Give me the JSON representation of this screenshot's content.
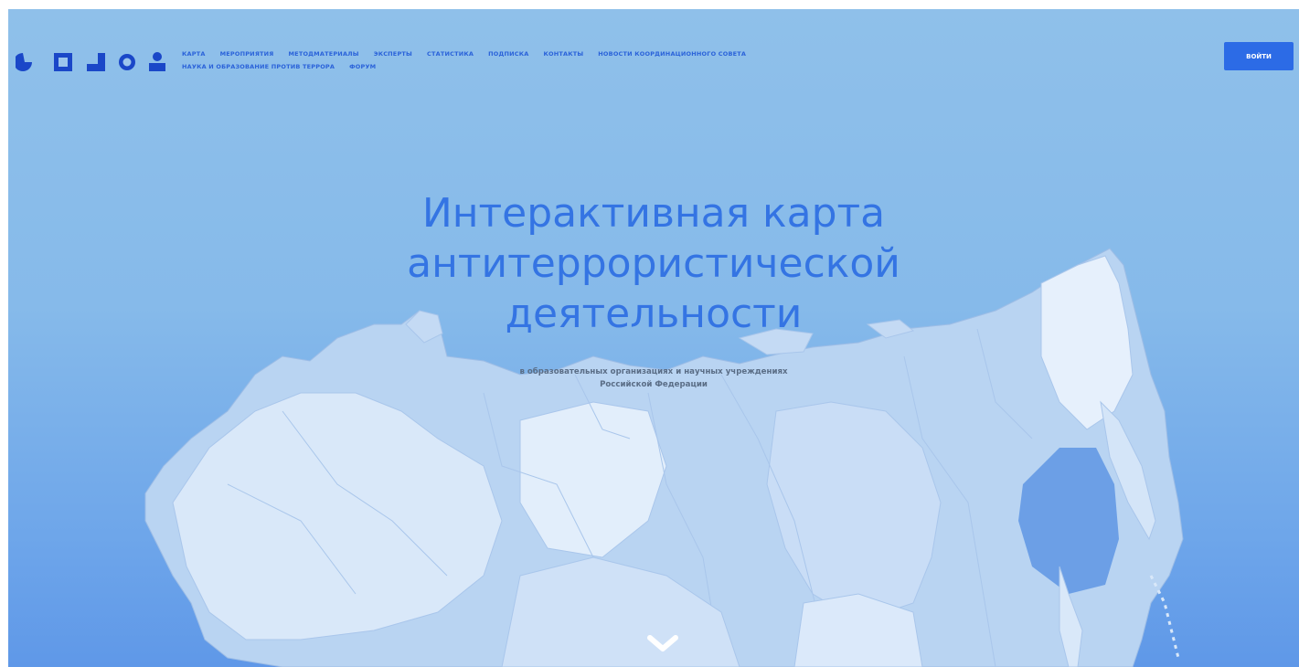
{
  "header": {
    "logo_name": "logo-shapes-icon",
    "nav_row1": [
      "КАРТА",
      "МЕРОПРИЯТИЯ",
      "МЕТОДМАТЕРИАЛЫ",
      "ЭКСПЕРТЫ",
      "СТАТИСТИКА",
      "ПОДПИСКА",
      "КОНТАКТЫ",
      "НОВОСТИ КООРДИНАЦИОННОГО СОВЕТА"
    ],
    "nav_row2": [
      "НАУКА И ОБРАЗОВАНИЕ ПРОТИВ ТЕРРОРА",
      "ФОРУМ"
    ],
    "login_label": "ВОЙТИ"
  },
  "hero": {
    "title": "Интерактивная карта антитеррористической деятельности",
    "subtitle_line1": "в образовательных организациях и научных учреждениях",
    "subtitle_line2": "Российской Федерации"
  },
  "scroll": {
    "icon": "chevron-down-icon"
  },
  "colors": {
    "accent": "#2c6be6",
    "title": "#3474e3",
    "background_top": "#8fc0ea",
    "background_bottom": "#5f98e8",
    "map_light": "#dce9f8",
    "map_mid": "#b9d4f2",
    "map_dark": "#7fb0ea"
  }
}
